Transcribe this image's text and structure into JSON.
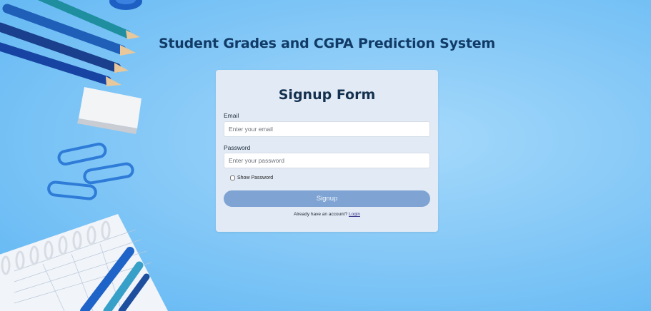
{
  "page": {
    "title": "Student Grades and CGPA Prediction System"
  },
  "form": {
    "title": "Signup Form",
    "email_label": "Email",
    "email_placeholder": "Enter your email",
    "email_value": "",
    "password_label": "Password",
    "password_placeholder": "Enter your password",
    "password_value": "",
    "show_password_label": "Show Password",
    "show_password_checked": false,
    "submit_label": "Signup",
    "footer_text": "Already have an account?",
    "login_link": "Login"
  },
  "colors": {
    "title": "#113b66",
    "card_background": "#e2eaf5",
    "button": "#7fa4d3",
    "link": "#3d3b8f"
  }
}
